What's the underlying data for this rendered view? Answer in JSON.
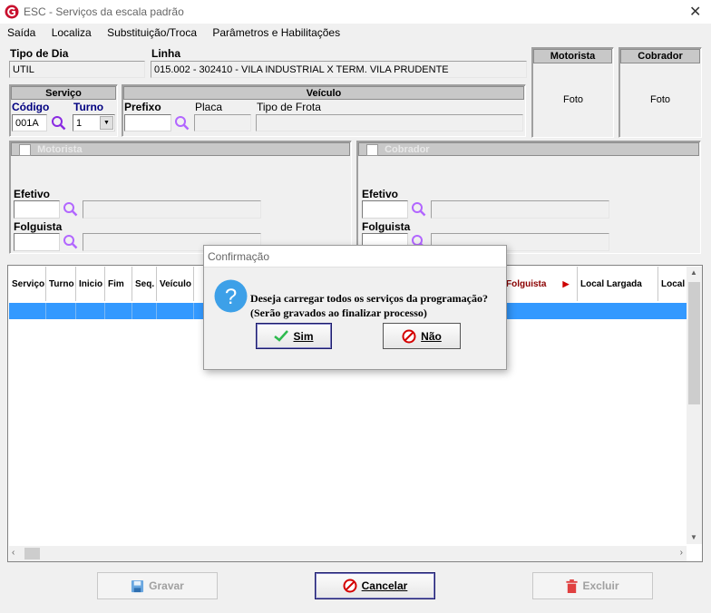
{
  "window": {
    "title": "ESC - Serviços da escala padrão"
  },
  "menu": [
    "Saída",
    "Localiza",
    "Substituição/Troca",
    "Parâmetros e Habilitações"
  ],
  "header": {
    "tipo_dia_label": "Tipo de Dia",
    "tipo_dia_value": "UTIL",
    "linha_label": "Linha",
    "linha_value": "015.002 - 302410 - VILA INDUSTRIAL X TERM. VILA PRUDENTE"
  },
  "motorista_panel": {
    "title": "Motorista",
    "foto": "Foto"
  },
  "cobrador_panel": {
    "title": "Cobrador",
    "foto": "Foto"
  },
  "servico": {
    "title": "Serviço",
    "codigo_label": "Código",
    "codigo_value": "001A",
    "turno_label": "Turno",
    "turno_value": "1"
  },
  "veiculo": {
    "title": "Veículo",
    "prefixo_label": "Prefixo",
    "placa_label": "Placa",
    "tipo_frota_label": "Tipo de Frota"
  },
  "motorista_group": {
    "title": "Motorista",
    "efetivo_label": "Efetivo",
    "folguista_label": "Folguista"
  },
  "cobrador_group": {
    "title": "Cobrador",
    "efetivo_label": "Efetivo",
    "folguista_label": "Folguista"
  },
  "grid": {
    "columns": [
      "Serviço",
      "Turno",
      "Inicio",
      "Fim",
      "Seq.",
      "Veículo"
    ],
    "right_columns": [
      "Folguista",
      "Local Largada",
      "Local"
    ]
  },
  "dialog": {
    "title": "Confirmação",
    "message_line1": "Deseja carregar todos os serviços da programação?",
    "message_line2": "(Serão gravados ao finalizar processo)",
    "yes_label": "Sim",
    "no_label": "Não"
  },
  "footer": {
    "gravar_label": "Gravar",
    "cancelar_label": "Cancelar",
    "excluir_label": "Excluir"
  },
  "colors": {
    "selection": "#3399ff",
    "accent_red": "#cc0000",
    "dialog_icon": "#3da0e8"
  }
}
